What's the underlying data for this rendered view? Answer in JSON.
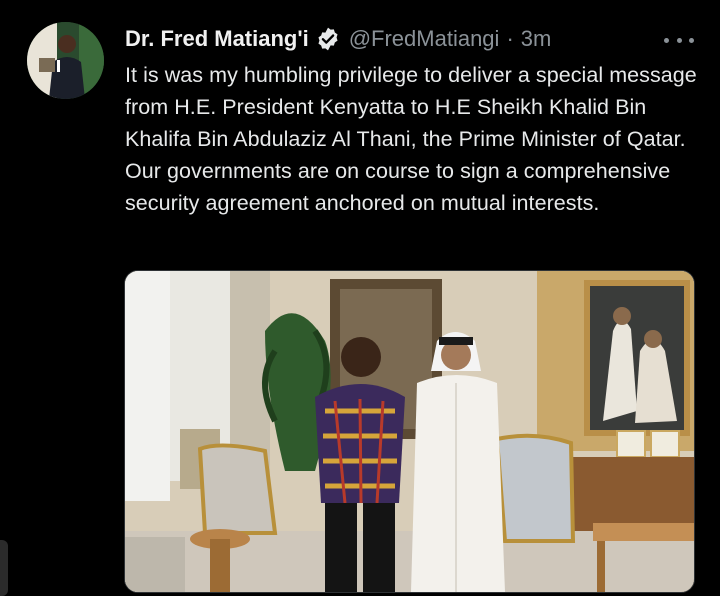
{
  "tweet": {
    "author_name": "Dr. Fred Matiang'i",
    "handle": "@FredMatiangi",
    "separator": "·",
    "timestamp": "3m",
    "body": "It is was my humbling privilege to deliver a special message from H.E. President Kenyatta to H.E Sheikh Khalid Bin Khalifa Bin Abdulaziz Al Thani, the Prime Minister of Qatar. Our governments are on course to sign a comprehensive security agreement anchored on mutual interests.",
    "verified": true
  },
  "colors": {
    "background": "#000000",
    "text": "#e7e9ea",
    "muted": "#8b9298",
    "verified_badge": "#e7e9ea"
  },
  "icons": [
    "verified-icon",
    "more-icon"
  ]
}
